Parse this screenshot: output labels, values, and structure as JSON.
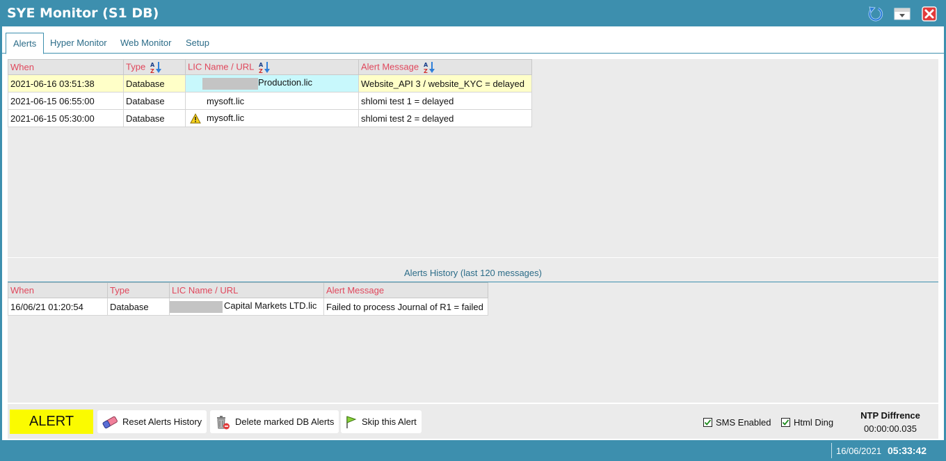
{
  "window": {
    "title": "SYE Monitor (S1 DB)"
  },
  "titlebar_icons": [
    "refresh-icon",
    "minimize-icon",
    "close-icon"
  ],
  "tabs": [
    {
      "label": "Alerts",
      "active": true
    },
    {
      "label": "Hyper Monitor"
    },
    {
      "label": "Web Monitor"
    },
    {
      "label": "Setup"
    }
  ],
  "alerts": {
    "columns": [
      "When",
      "Type",
      "LIC Name / URL",
      "Alert Message"
    ],
    "rows": [
      {
        "when": "2021-06-16  03:51:38",
        "type": "Database",
        "lic": "Production.lic",
        "message": "Website_API 3 / website_KYC = delayed"
      },
      {
        "when": "2021-06-15  06:55:00",
        "type": "Database",
        "lic": "mysoft.lic",
        "message": "shlomi test 1 = delayed"
      },
      {
        "when": "2021-06-15  05:30:00",
        "type": "Database",
        "lic": "mysoft.lic",
        "message": "shlomi test 2 = delayed"
      }
    ]
  },
  "history": {
    "caption": "Alerts History (last 120 messages)",
    "columns": [
      "When",
      "Type",
      "LIC Name / URL",
      "Alert Message"
    ],
    "rows": [
      {
        "when": "16/06/21 01:20:54",
        "type": "Database",
        "lic": "Capital Markets LTD.lic",
        "message": "Failed to process Journal of R1 = failed"
      }
    ]
  },
  "footer": {
    "alert_label": "ALERT",
    "reset_label": "Reset Alerts History",
    "delete_label": "Delete marked DB Alerts",
    "skip_label": "Skip this Alert",
    "sms_label": "SMS Enabled",
    "html_ding_label": "Html Ding",
    "ntp_title": "NTP Diffrence",
    "ntp_value": "00:00:00.035"
  },
  "status": {
    "date": "16/06/2021",
    "time": "05:33:42"
  },
  "colors": {
    "accent": "#3d8fae",
    "header_text": "#e0475c",
    "alert": "#fbfb00"
  }
}
